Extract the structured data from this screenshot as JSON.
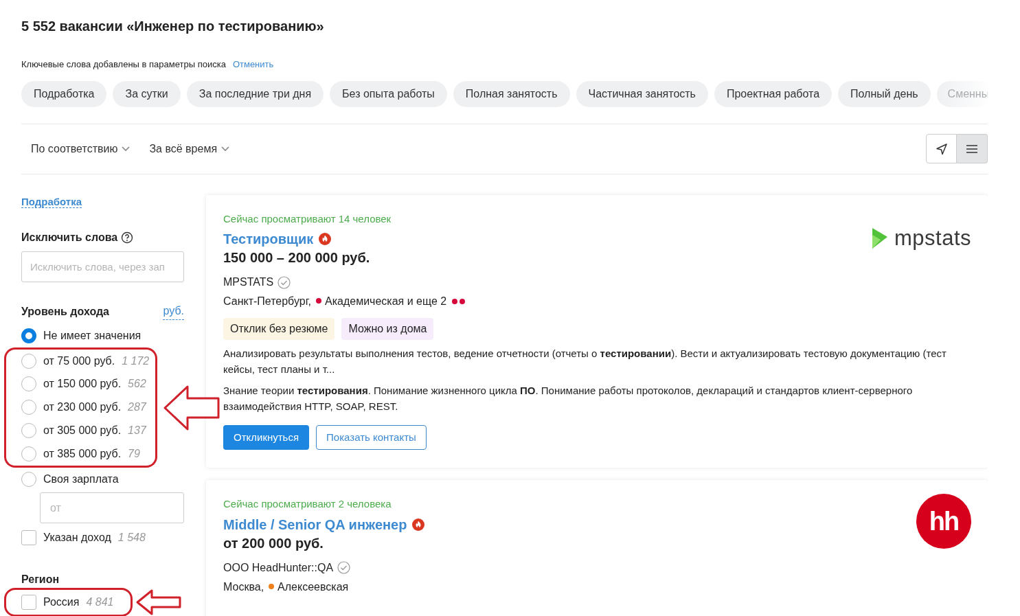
{
  "header": {
    "title": "5 552 вакансии «Инженер по тестированию»",
    "keywords_note": "Ключевые слова добавлены в параметры поиска",
    "cancel_link": "Отменить"
  },
  "chips": [
    {
      "label": "Подработка",
      "faded": false
    },
    {
      "label": "За сутки",
      "faded": false
    },
    {
      "label": "За последние три дня",
      "faded": false
    },
    {
      "label": "Без опыта работы",
      "faded": false
    },
    {
      "label": "Полная занятость",
      "faded": false
    },
    {
      "label": "Частичная занятость",
      "faded": false
    },
    {
      "label": "Проектная работа",
      "faded": false
    },
    {
      "label": "Полный день",
      "faded": false
    },
    {
      "label": "Сменны",
      "faded": true
    }
  ],
  "sort": [
    {
      "label": "По соответствию"
    },
    {
      "label": "За всё время"
    }
  ],
  "view_buttons": [
    {
      "kind": "map",
      "selected": false
    },
    {
      "kind": "list",
      "selected": true
    }
  ],
  "sidebar": {
    "link": "Подработка",
    "exclude": {
      "title": "Исключить слова",
      "placeholder": "Исключить слова, через зап"
    },
    "income": {
      "title": "Уровень дохода",
      "currency": "руб.",
      "options": [
        {
          "label": "Не имеет значения",
          "selected": true
        },
        {
          "label": "от 75 000 руб.",
          "count": "1 172",
          "selected": false,
          "highlighted": true
        },
        {
          "label": "от 150 000 руб.",
          "count": "562",
          "selected": false,
          "highlighted": true
        },
        {
          "label": "от 230 000 руб.",
          "count": "287",
          "selected": false,
          "highlighted": true
        },
        {
          "label": "от 305 000 руб.",
          "count": "137",
          "selected": false,
          "highlighted": true
        },
        {
          "label": "от 385 000 руб.",
          "count": "79",
          "selected": false,
          "highlighted": true
        },
        {
          "label": "Своя зарплата",
          "selected": false
        }
      ],
      "custom_placeholder": "от",
      "salary_given": {
        "label": "Указан доход",
        "count": "1 548",
        "checked": false
      }
    },
    "region": {
      "title": "Регион",
      "items": [
        {
          "label": "Россия",
          "count": "4 841",
          "checked": false,
          "highlighted": true
        }
      ]
    }
  },
  "vacancies": [
    {
      "viewers": "Сейчас просматривают 14 человек",
      "title": "Тестировщик",
      "hot": true,
      "salary": "150 000 – 200 000 руб.",
      "logo": {
        "kind": "mpstats",
        "text": "mpstats"
      },
      "company": "MPSTATS",
      "verified": true,
      "city": "Санкт-Петербург,",
      "metro": {
        "label": "Академическая и еще 2",
        "color": "#d6083b",
        "more": [
          {
            "color": "#d6083b"
          },
          {
            "color": "#d6083b"
          }
        ]
      },
      "tags": [
        {
          "label": "Отклик без резюме",
          "kind": "response"
        },
        {
          "label": "Можно из дома",
          "kind": "remote"
        }
      ],
      "paragraphs": [
        "Анализировать результаты выполнения тестов, ведение отчетности (отчеты о **тестировании**). Вести и актуализировать тестовую документацию (тест кейсы, тест планы и т...",
        "Знание теории **тестирования**. Понимание жизненного цикла **ПО**. Понимание работы протоколов, деклараций и стандартов клиент-серверного взаимодействия HTTP, SOAP, REST."
      ],
      "buttons": [
        {
          "label": "Откликнуться",
          "kind": "primary"
        },
        {
          "label": "Показать контакты",
          "kind": "outline"
        }
      ]
    },
    {
      "viewers": "Сейчас просматривают 2 человека",
      "title": "Middle / Senior QA инженер",
      "hot": true,
      "salary": "от 200 000 руб.",
      "logo": {
        "kind": "hh",
        "text": "hh"
      },
      "company": "ООО HeadHunter::QA",
      "verified": true,
      "city": "Москва,",
      "metro": {
        "label": "Алексеевская",
        "color": "#ef7f1a"
      }
    }
  ]
}
